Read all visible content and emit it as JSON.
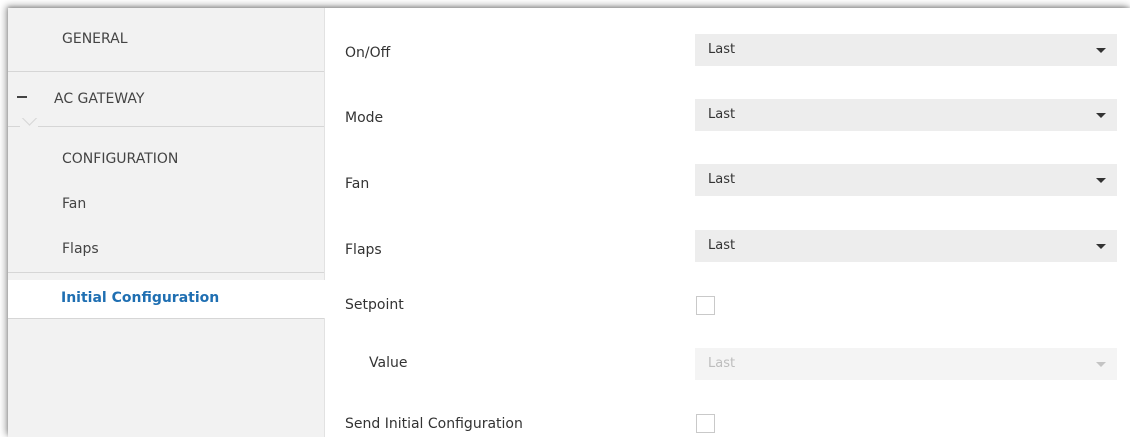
{
  "sidebar": {
    "general": "GENERAL",
    "ac_gateway": "AC GATEWAY",
    "configuration": "CONFIGURATION",
    "fan": "Fan",
    "flaps": "Flaps",
    "initial_configuration": "Initial Configuration"
  },
  "form": {
    "on_off": {
      "label": "On/Off",
      "value": "Last"
    },
    "mode": {
      "label": "Mode",
      "value": "Last"
    },
    "fan": {
      "label": "Fan",
      "value": "Last"
    },
    "flaps": {
      "label": "Flaps",
      "value": "Last"
    },
    "setpoint": {
      "label": "Setpoint",
      "checked": false
    },
    "value": {
      "label": "Value",
      "value": "Last",
      "disabled": true
    },
    "send_initial": {
      "label": "Send Initial Configuration",
      "checked": false
    }
  },
  "colors": {
    "accent": "#1f6fb2",
    "sidebar_bg": "#f2f2f2",
    "select_bg": "#ededed"
  },
  "icons": {
    "collapse": "minus-icon",
    "dropdown": "caret-down-icon"
  }
}
